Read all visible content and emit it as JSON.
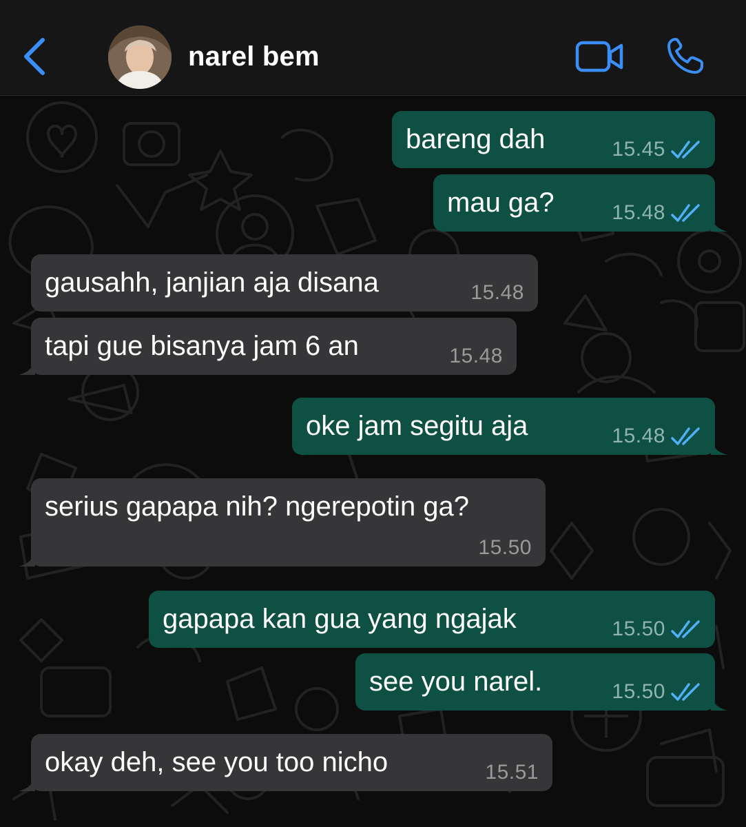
{
  "header": {
    "contact_name": "narel bem",
    "back_icon": "chevron-left-icon",
    "video_icon": "video-camera-icon",
    "call_icon": "phone-icon",
    "accent_color": "#3a8ef5"
  },
  "messages": [
    {
      "direction": "out",
      "text": "bareng dah",
      "time": "15.45",
      "status": "read"
    },
    {
      "direction": "out",
      "text": "mau ga?",
      "time": "15.48",
      "status": "read"
    },
    {
      "direction": "in",
      "text": "gausahh, janjian aja disana",
      "time": "15.48"
    },
    {
      "direction": "in",
      "text": "tapi gue bisanya jam 6 an",
      "time": "15.48"
    },
    {
      "direction": "out",
      "text": "oke jam segitu aja",
      "time": "15.48",
      "status": "read"
    },
    {
      "direction": "in",
      "text": "serius gapapa nih? ngerepotin ga?",
      "time": "15.50"
    },
    {
      "direction": "out",
      "text": "gapapa kan gua yang ngajak",
      "time": "15.50",
      "status": "read"
    },
    {
      "direction": "out",
      "text": "see you narel.",
      "time": "15.50",
      "status": "read"
    },
    {
      "direction": "in",
      "text": "okay deh, see you too nicho",
      "time": "15.51"
    }
  ],
  "colors": {
    "outgoing_bubble": "#0f5045",
    "incoming_bubble": "#363638",
    "read_tick": "#4fb0f7"
  }
}
